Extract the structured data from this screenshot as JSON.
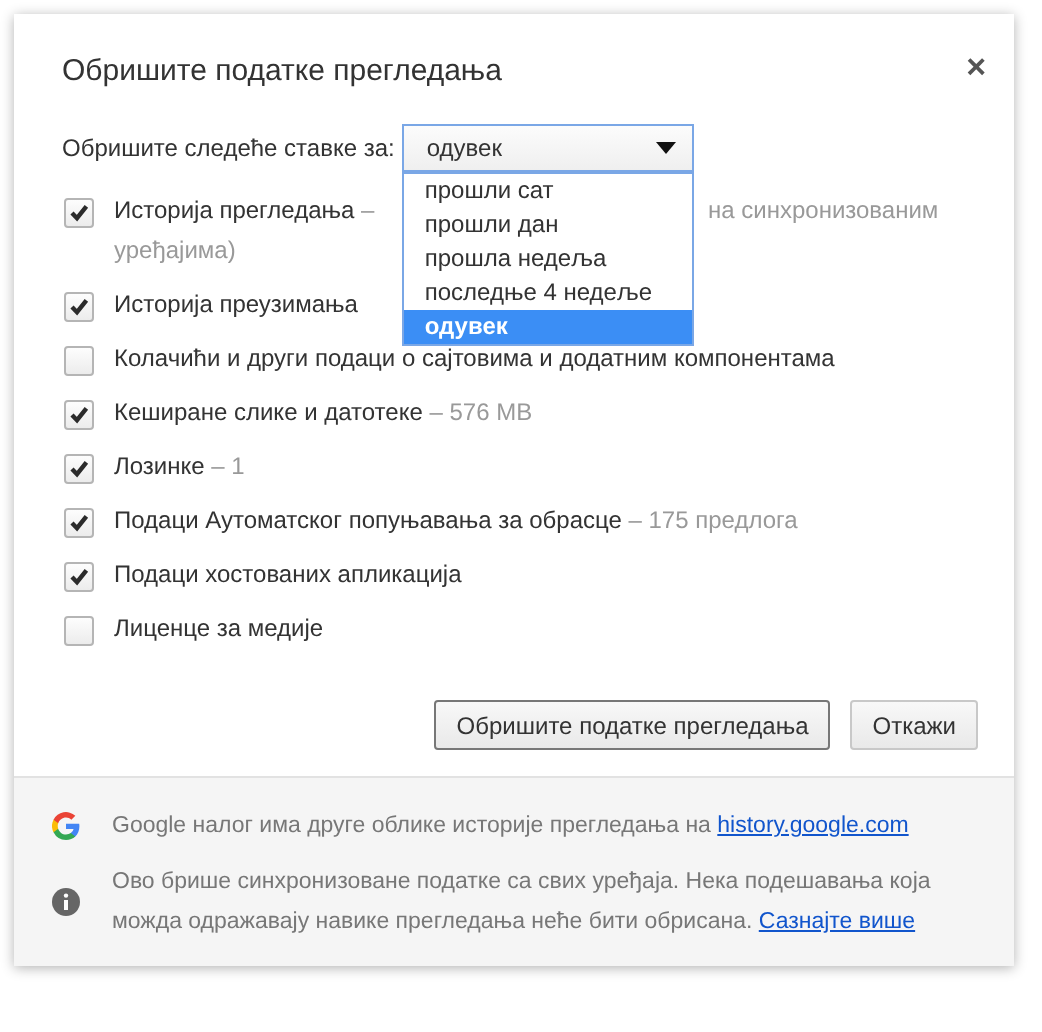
{
  "dialog": {
    "title": "Обришите податке прегледања",
    "close": "×"
  },
  "period": {
    "label": "Обришите следеће ставке за:",
    "value": "одувек",
    "expanded": true,
    "options": [
      {
        "label": "прошли сат",
        "selected": false
      },
      {
        "label": "прошли дан",
        "selected": false
      },
      {
        "label": "прошла недеља",
        "selected": false
      },
      {
        "label": "последње 4 недеље",
        "selected": false
      },
      {
        "label": "одувек",
        "selected": true
      }
    ]
  },
  "items": [
    {
      "label": "Историја прегледања",
      "detail": "–",
      "detail_after_menu": "на синхронизованим",
      "detail_next_line": "уређајима)",
      "checked": true
    },
    {
      "label": "Историја преузимања",
      "checked": true
    },
    {
      "label": "Колачићи и други подаци о сајтовима и додатним компонентама",
      "checked": false
    },
    {
      "label": "Кеширане слике и датотеке",
      "detail": "– 576 MB",
      "checked": true
    },
    {
      "label": "Лозинке",
      "detail": "– 1",
      "checked": true
    },
    {
      "label": "Подаци Аутоматског попуњавања за обрасце",
      "detail": "– 175 предлога",
      "checked": true
    },
    {
      "label": "Подаци хостованих апликација",
      "checked": true
    },
    {
      "label": "Лиценце за медије",
      "checked": false
    }
  ],
  "buttons": [
    {
      "label": "Обришите податке прегледања",
      "default": true
    },
    {
      "label": "Откажи",
      "default": false
    }
  ],
  "footer": [
    {
      "kind": "google",
      "text": "Google налог има друге облике историје прегледања на ",
      "link": "history.google.com"
    },
    {
      "kind": "info",
      "text": "Ово брише синхронизоване податке са свих уређаја. Нека подешавања која можда одражавају навике прегледања неће бити обрисана. ",
      "link": "Сазнајте више"
    }
  ]
}
